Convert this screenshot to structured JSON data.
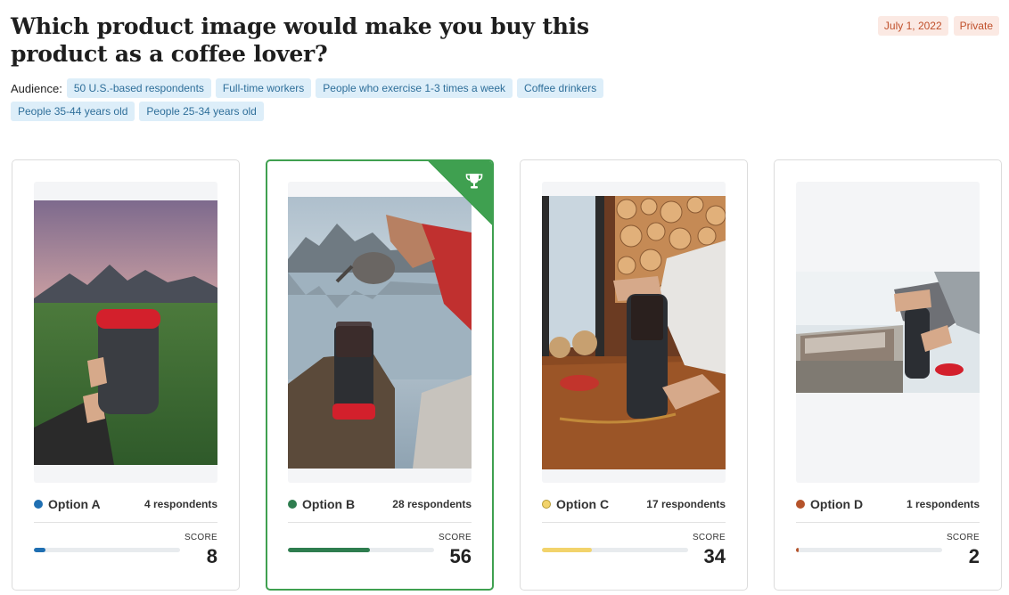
{
  "survey": {
    "question": "Which product image would make you buy this product as a coffee lover?",
    "date": "July 1, 2022",
    "visibility": "Private"
  },
  "audience": {
    "label": "Audience:",
    "tags": [
      "50 U.S.-based respondents",
      "Full-time workers",
      "People who exercise 1-3 times a week",
      "Coffee drinkers",
      "People 35-44 years old",
      "People 25-34 years old"
    ]
  },
  "score_label": "SCORE",
  "options": [
    {
      "name": "Option A",
      "respondents": "4 respondents",
      "score": "8",
      "score_fraction": 0.08,
      "color": "#1f6fb2",
      "winner": false
    },
    {
      "name": "Option B",
      "respondents": "28 respondents",
      "score": "56",
      "score_fraction": 0.56,
      "color": "#2e7d4f",
      "winner": true,
      "badge_icon": "trophy-icon"
    },
    {
      "name": "Option C",
      "respondents": "17 respondents",
      "score": "34",
      "score_fraction": 0.34,
      "color": "#f2d36b",
      "winner": false
    },
    {
      "name": "Option D",
      "respondents": "1 respondents",
      "score": "2",
      "score_fraction": 0.02,
      "color": "#b5532a",
      "winner": false
    }
  ],
  "colors": {
    "winner_border": "#3fa050",
    "tag_bg": "#ddeef9",
    "tag_text": "#2f6f9a",
    "meta_bg": "#fbe9e3",
    "meta_text": "#c0502b"
  }
}
